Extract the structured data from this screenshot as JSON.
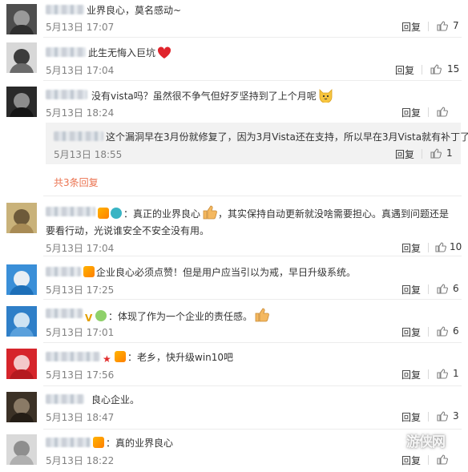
{
  "comments": [
    {
      "text": "业界良心，莫名感动~",
      "time": "5月13日 17:07",
      "reply_label": "回复",
      "likes": "7",
      "avatar_colors": [
        "#4e4e4e",
        "#9a9a9a",
        "#2f2f2f"
      ]
    },
    {
      "text": "此生无悔入巨坑",
      "emoji": "heart",
      "time": "5月13日 17:04",
      "reply_label": "回复",
      "likes": "15",
      "avatar_colors": [
        "#d8d8d8",
        "#3c3c3c",
        "#6b6b6b"
      ]
    },
    {
      "text": "没有vista吗？虽然很不争气但好歹坚持到了上个月呢",
      "emoji": "cat",
      "time": "5月13日 18:24",
      "reply_label": "回复",
      "likes": "",
      "avatar_colors": [
        "#2a2a2a",
        "#8c8c8c",
        "#151515"
      ],
      "nested_reply": {
        "text": "这个漏洞早在3月份就修复了，因为3月Vista还在支持，所以早在3月Vista就有补丁了",
        "time": "5月13日 18:55",
        "reply_label": "回复",
        "likes": "1"
      },
      "more_replies": "共3条回复"
    },
    {
      "text": "：真正的业界良心",
      "text_cont": "，其实保持自动更新就没啥需要担心。真遇到问题还是",
      "text_line2": "要看行动，光说谁安全不安全没有用。",
      "emoji": "thumb",
      "time": "5月13日 17:04",
      "reply_label": "回复",
      "likes": "10",
      "avatar_colors": [
        "#c9b27a",
        "#6d5a3a",
        "#a88b55"
      ]
    },
    {
      "text": "企业良心必须点赞！但是用户应当引以为戒，早日升级系统。",
      "time": "5月13日 17:25",
      "reply_label": "回复",
      "likes": "6",
      "avatar_colors": [
        "#3a8fd8",
        "#e8eef4",
        "#1d6fb8"
      ]
    },
    {
      "text": "：体现了作为一个企业的责任感。",
      "emoji": "thumb",
      "time": "5月13日 17:01",
      "reply_label": "回复",
      "likes": "6",
      "avatar_colors": [
        "#2f7fc8",
        "#cfe3f3",
        "#5aa0dc"
      ]
    },
    {
      "text": "：老乡，快升级win10吧",
      "time": "5月13日 17:56",
      "reply_label": "回复",
      "likes": "1",
      "avatar_colors": [
        "#d6252b",
        "#f3c9c9",
        "#b51a1f"
      ]
    },
    {
      "text": "良心企业。",
      "time": "5月13日 18:47",
      "reply_label": "回复",
      "likes": "3",
      "avatar_colors": [
        "#3b3126",
        "#8a7a66",
        "#241d16"
      ]
    },
    {
      "text": "：真的业界良心",
      "time": "5月13日 18:22",
      "reply_label": "回复",
      "likes": "",
      "avatar_colors": [
        "#d9d9d9",
        "#8e8e8e",
        "#b0b0b0"
      ]
    }
  ],
  "watermark": "游侠网"
}
